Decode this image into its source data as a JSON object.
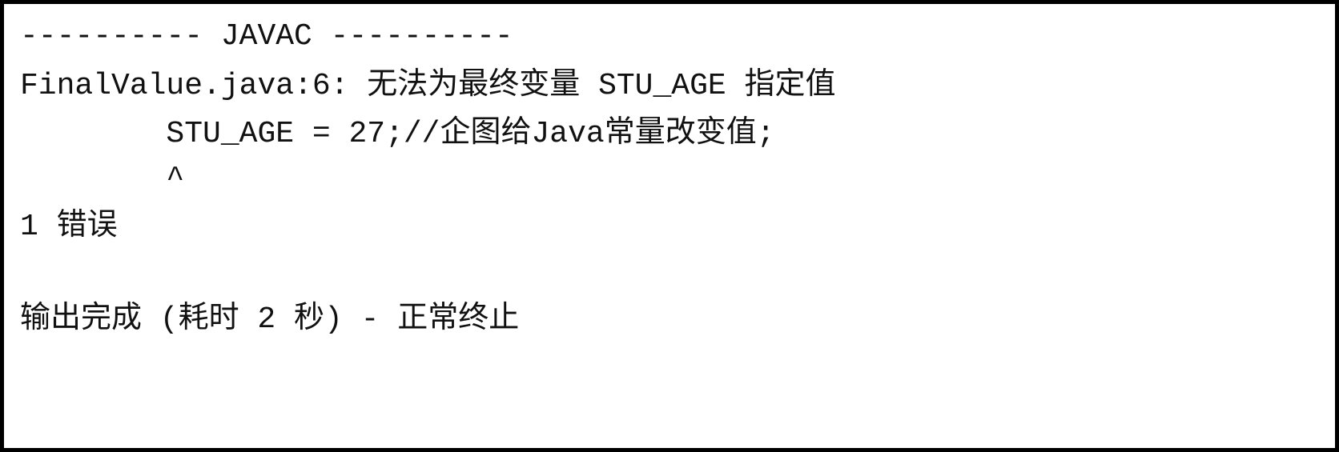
{
  "console": {
    "header": "---------- JAVAC ----------",
    "error_message": "FinalValue.java:6: 无法为最终变量 STU_AGE 指定值",
    "source_line": "        STU_AGE = 27;//企图给Java常量改变值;",
    "caret_line": "        ^",
    "error_count": "1 错误",
    "completion_status": "输出完成 (耗时 2 秒) - 正常终止"
  }
}
